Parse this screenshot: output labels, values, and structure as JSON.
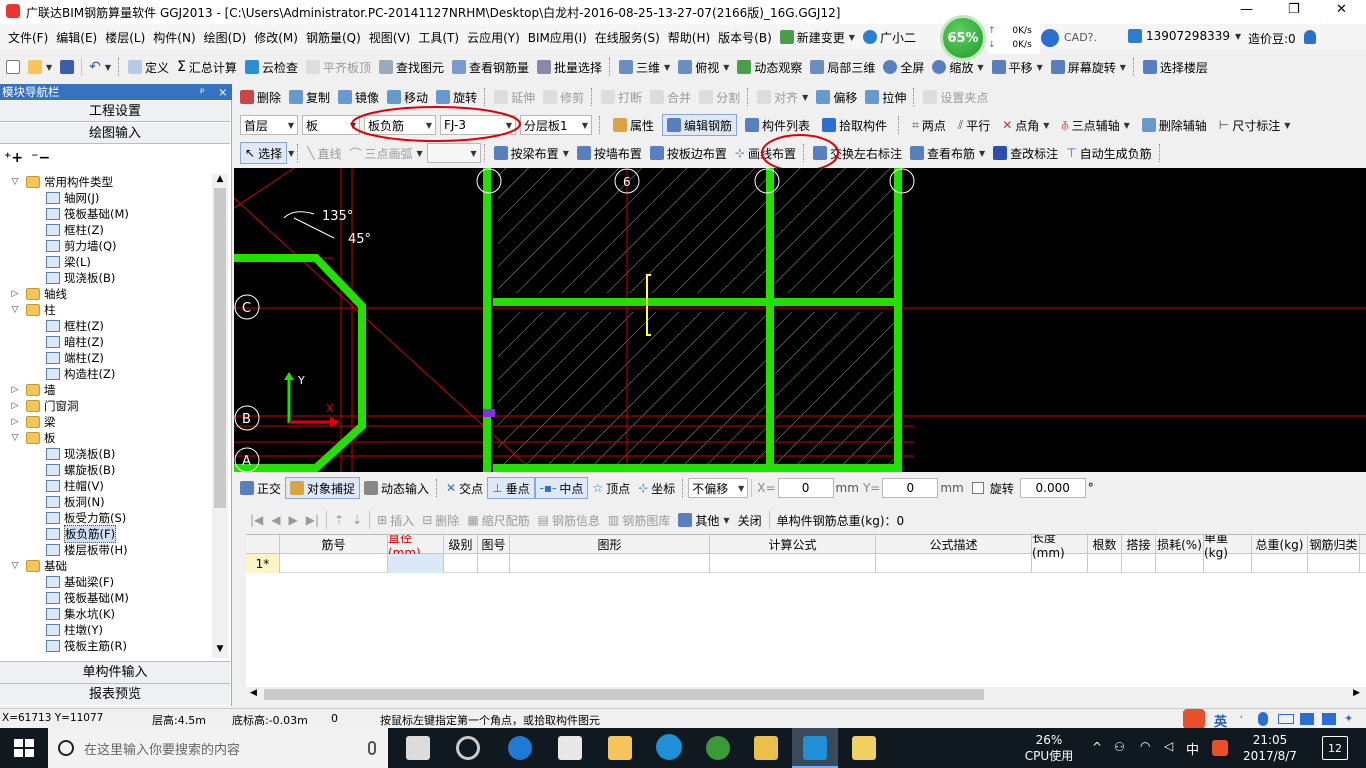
{
  "title_bar": {
    "title": "广联达BIM钢筋算量软件 GGJ2013 - [C:\\Users\\Administrator.PC-20141127NRHM\\Desktop\\白龙村-2016-08-25-13-27-07(2166版)_16G.GGJ12]",
    "minimize": "—",
    "restore": "❐",
    "close": "✕"
  },
  "menu": [
    "文件(F)",
    "编辑(E)",
    "楼层(L)",
    "构件(N)",
    "绘图(D)",
    "修改(M)",
    "钢筋量(Q)",
    "视图(V)",
    "工具(T)",
    "云应用(Y)",
    "BIM应用(I)",
    "在线服务(S)",
    "帮助(H)",
    "版本号(B)"
  ],
  "menu_extra": {
    "new_change": "新建变更",
    "guang_xiao_er": "广小二",
    "cpu_gauge": "65%",
    "net_up": "0K/s",
    "net_down": "0K/s",
    "cad_text": "CAD?.",
    "phone": "13907298339",
    "zaojiadou": "造价豆:0"
  },
  "toolbar1": [
    "定义",
    "汇总计算",
    "云检查",
    "平齐板顶",
    "查找图元",
    "查看钢筋量",
    "批量选择",
    "三维",
    "俯视",
    "动态观察",
    "局部三维",
    "全屏",
    "缩放",
    "平移",
    "屏幕旋转",
    "选择楼层"
  ],
  "toolbar2": [
    "删除",
    "复制",
    "镜像",
    "移动",
    "旋转",
    "延伸",
    "修剪",
    "打断",
    "合并",
    "分割",
    "对齐",
    "偏移",
    "拉伸",
    "设置夹点"
  ],
  "toolbar3": {
    "floor": "首层",
    "category": "板",
    "type": "板负筋",
    "name": "FJ-3",
    "layer": "分层板1",
    "buttons": [
      "属性",
      "编辑钢筋",
      "构件列表",
      "拾取构件",
      "两点",
      "平行",
      "点角",
      "三点辅轴",
      "删除辅轴",
      "尺寸标注"
    ]
  },
  "toolbar4": [
    "选择",
    "直线",
    "三点画弧",
    "按梁布置",
    "按墙布置",
    "按板边布置",
    "画线布置",
    "交换左右标注",
    "查看布筋",
    "查改标注",
    "自动生成负筋"
  ],
  "left_panel": {
    "header": "模块导航栏",
    "pin": "ᵖ",
    "close": "×",
    "tab_project": "工程设置",
    "tab_draw": "绘图输入",
    "tab_single": "单构件输入",
    "tab_report": "报表预览",
    "tree": [
      {
        "level": 0,
        "exp": "▽",
        "folder": true,
        "label": "常用构件类型"
      },
      {
        "level": 1,
        "label": "轴网(J)"
      },
      {
        "level": 1,
        "label": "筏板基础(M)"
      },
      {
        "level": 1,
        "label": "框柱(Z)"
      },
      {
        "level": 1,
        "label": "剪力墙(Q)"
      },
      {
        "level": 1,
        "label": "梁(L)"
      },
      {
        "level": 1,
        "label": "现浇板(B)"
      },
      {
        "level": 0,
        "exp": "▷",
        "folder": true,
        "label": "轴线"
      },
      {
        "level": 0,
        "exp": "▽",
        "folder": true,
        "label": "柱"
      },
      {
        "level": 1,
        "label": "框柱(Z)"
      },
      {
        "level": 1,
        "label": "暗柱(Z)"
      },
      {
        "level": 1,
        "label": "端柱(Z)"
      },
      {
        "level": 1,
        "label": "构造柱(Z)"
      },
      {
        "level": 0,
        "exp": "▷",
        "folder": true,
        "label": "墙"
      },
      {
        "level": 0,
        "exp": "▷",
        "folder": true,
        "label": "门窗洞"
      },
      {
        "level": 0,
        "exp": "▷",
        "folder": true,
        "label": "梁"
      },
      {
        "level": 0,
        "exp": "▽",
        "folder": true,
        "label": "板"
      },
      {
        "level": 1,
        "label": "现浇板(B)"
      },
      {
        "level": 1,
        "label": "螺旋板(B)"
      },
      {
        "level": 1,
        "label": "柱帽(V)"
      },
      {
        "level": 1,
        "label": "板洞(N)"
      },
      {
        "level": 1,
        "label": "板受力筋(S)"
      },
      {
        "level": 1,
        "label": "板负筋(F)",
        "selected": true
      },
      {
        "level": 1,
        "label": "楼层板带(H)"
      },
      {
        "level": 0,
        "exp": "▽",
        "folder": true,
        "label": "基础"
      },
      {
        "level": 1,
        "label": "基础梁(F)"
      },
      {
        "level": 1,
        "label": "筏板基础(M)"
      },
      {
        "level": 1,
        "label": "集水坑(K)"
      },
      {
        "level": 1,
        "label": "柱墩(Y)"
      },
      {
        "level": 1,
        "label": "筏板主筋(R)"
      }
    ]
  },
  "canvas": {
    "angle1": "135°",
    "angle2": "45°",
    "axis_c": "C",
    "axis_b": "B",
    "axis_a": "A",
    "axis_6": "6",
    "y_label": "Y",
    "x_label": "X"
  },
  "snap_bar": {
    "items": [
      "正交",
      "对象捕捉",
      "动态输入",
      "交点",
      "垂点",
      "中点",
      "顶点",
      "坐标"
    ],
    "offset": "不偏移",
    "x_label": "X=",
    "x_val": "0",
    "y_label": "Y=",
    "y_val": "0",
    "unit": "mm",
    "rotate": "旋转",
    "rotate_val": "0.000",
    "deg": "°"
  },
  "rebar_toolbar": {
    "items": [
      "插入",
      "删除",
      "缩尺配筋",
      "钢筋信息",
      "钢筋图库",
      "其他",
      "关闭"
    ],
    "total": "单构件钢筋总重(kg)：0"
  },
  "table": {
    "headers": [
      "筋号",
      "直径(mm)",
      "级别",
      "图号",
      "图形",
      "计算公式",
      "公式描述",
      "长度(mm)",
      "根数",
      "搭接",
      "损耗(%)",
      "单重(kg)",
      "总重(kg)",
      "钢筋归类"
    ],
    "row_label": "1*"
  },
  "status": {
    "coords": "X=61713 Y=11077",
    "floor_height": "层高:4.5m",
    "bottom_elev": "底标高:-0.03m",
    "zero": "0",
    "hint": "按鼠标左键指定第一个角点，或拾取构件图元",
    "ime": "英"
  },
  "taskbar": {
    "search_placeholder": "在这里输入你要搜索的内容",
    "cpu_pct": "26%",
    "cpu_label": "CPU使用",
    "ime": "中",
    "time": "21:05",
    "date": "2017/8/7",
    "notif": "12"
  },
  "colors": {
    "accent_green": "#22e000",
    "red": "#e00000",
    "win_blue": "#1f7ad6"
  }
}
